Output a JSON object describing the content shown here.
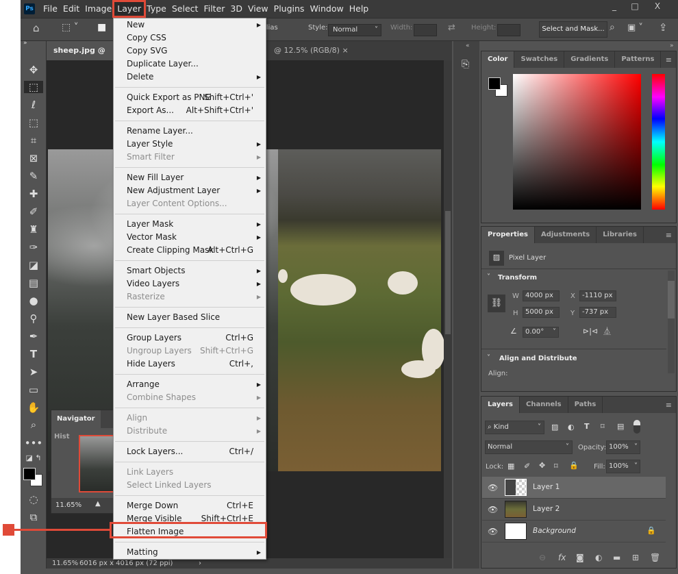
{
  "menubar": {
    "logo": "Ps",
    "items": [
      "File",
      "Edit",
      "Image",
      "Layer",
      "Type",
      "Select",
      "Filter",
      "3D",
      "View",
      "Plugins",
      "Window",
      "Help"
    ],
    "active": "Layer",
    "window_buttons": [
      "_",
      "□",
      "X"
    ]
  },
  "options": {
    "antialias": "nti-alias",
    "style_label": "Style:",
    "style_value": "Normal",
    "width_label": "Width:",
    "height_label": "Height:",
    "select_mask": "Select and Mask..."
  },
  "tabs": [
    {
      "label": "sheep.jpg @ 11.6"
    },
    {
      "label": "@ 12.5% (RGB/8)",
      "close": "×"
    }
  ],
  "layer_menu": [
    [
      {
        "label": "New",
        "submenu": true
      },
      {
        "label": "Copy CSS"
      },
      {
        "label": "Copy SVG"
      },
      {
        "label": "Duplicate Layer..."
      },
      {
        "label": "Delete",
        "submenu": true
      }
    ],
    [
      {
        "label": "Quick Export as PNG",
        "shortcut": "Shift+Ctrl+'"
      },
      {
        "label": "Export As...",
        "shortcut": "Alt+Shift+Ctrl+'"
      }
    ],
    [
      {
        "label": "Rename Layer..."
      },
      {
        "label": "Layer Style",
        "submenu": true
      },
      {
        "label": "Smart Filter",
        "submenu": true,
        "disabled": true
      }
    ],
    [
      {
        "label": "New Fill Layer",
        "submenu": true
      },
      {
        "label": "New Adjustment Layer",
        "submenu": true
      },
      {
        "label": "Layer Content Options...",
        "disabled": true
      }
    ],
    [
      {
        "label": "Layer Mask",
        "submenu": true
      },
      {
        "label": "Vector Mask",
        "submenu": true
      },
      {
        "label": "Create Clipping Mask",
        "shortcut": "Alt+Ctrl+G"
      }
    ],
    [
      {
        "label": "Smart Objects",
        "submenu": true
      },
      {
        "label": "Video Layers",
        "submenu": true
      },
      {
        "label": "Rasterize",
        "submenu": true,
        "disabled": true
      }
    ],
    [
      {
        "label": "New Layer Based Slice"
      }
    ],
    [
      {
        "label": "Group Layers",
        "shortcut": "Ctrl+G"
      },
      {
        "label": "Ungroup Layers",
        "shortcut": "Shift+Ctrl+G",
        "disabled": true
      },
      {
        "label": "Hide Layers",
        "shortcut": "Ctrl+,"
      }
    ],
    [
      {
        "label": "Arrange",
        "submenu": true
      },
      {
        "label": "Combine Shapes",
        "submenu": true,
        "disabled": true
      }
    ],
    [
      {
        "label": "Align",
        "submenu": true,
        "disabled": true
      },
      {
        "label": "Distribute",
        "submenu": true,
        "disabled": true
      }
    ],
    [
      {
        "label": "Lock Layers...",
        "shortcut": "Ctrl+/"
      }
    ],
    [
      {
        "label": "Link Layers",
        "disabled": true
      },
      {
        "label": "Select Linked Layers",
        "disabled": true
      }
    ],
    [
      {
        "label": "Merge Down",
        "shortcut": "Ctrl+E"
      },
      {
        "label": "Merge Visible",
        "shortcut": "Shift+Ctrl+E"
      },
      {
        "label": "Flatten Image",
        "highlighted": true
      }
    ],
    [
      {
        "label": "Matting",
        "submenu": true
      }
    ]
  ],
  "color_panel": {
    "tabs": [
      "Color",
      "Swatches",
      "Gradients",
      "Patterns"
    ],
    "active": "Color",
    "hue": "#ff0000",
    "foreground": "#000000",
    "background": "#ffffff"
  },
  "properties": {
    "tabs": [
      "Properties",
      "Adjustments",
      "Libraries"
    ],
    "active": "Properties",
    "kind": "Pixel Layer",
    "transform_title": "Transform",
    "w_label": "W",
    "w": "4000 px",
    "h_label": "H",
    "h": "5000 px",
    "x_label": "X",
    "x": "-1110 px",
    "y_label": "Y",
    "y": "-737 px",
    "angle": "0.00°",
    "align_title": "Align and Distribute",
    "align_label": "Align:"
  },
  "layers_panel": {
    "tabs": [
      "Layers",
      "Channels",
      "Paths"
    ],
    "active": "Layers",
    "filter": "Kind",
    "blend": "Normal",
    "opacity_label": "Opacity:",
    "opacity": "100%",
    "lock_label": "Lock:",
    "fill_label": "Fill:",
    "fill": "100%",
    "layers": [
      {
        "name": "Layer 1",
        "selected": true
      },
      {
        "name": "Layer 2"
      },
      {
        "name": "Background",
        "locked": true
      }
    ]
  },
  "navigator": {
    "tabs": [
      "Navigator",
      "Hist"
    ],
    "zoom": "11.65%"
  },
  "status": {
    "zoom": "11.65%",
    "doc_size": "6016 px x 4016 px (72 ppi)"
  },
  "annotation_color": "#e04a38"
}
